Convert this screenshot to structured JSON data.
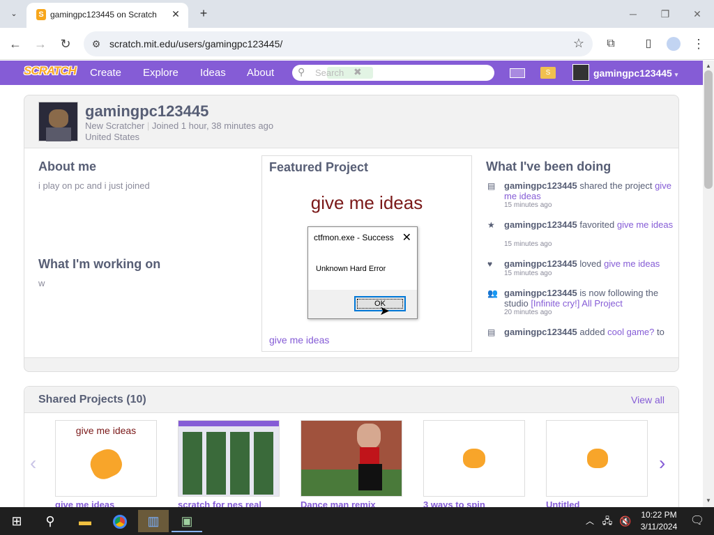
{
  "browser": {
    "tab_title": "gamingpc123445 on Scratch",
    "url": "scratch.mit.edu/users/gamingpc123445/",
    "new_tab": "+",
    "close_tab": "✕"
  },
  "scratch_nav": {
    "logo": "SCRATCH",
    "links": [
      "Create",
      "Explore",
      "Ideas",
      "About"
    ],
    "search_placeholder": "Search",
    "username": "gamingpc123445",
    "mystuff_glyph": "S"
  },
  "profile": {
    "username": "gamingpc123445",
    "rank": "New Scratcher",
    "joined": "Joined 1 hour, 38 minutes ago",
    "location": "United States",
    "about_title": "About me",
    "about_text": "i play on pc and i just joined",
    "working_title": "What I'm working on",
    "working_text": "w",
    "featured_title": "Featured Project",
    "featured_project_art_title": "give me ideas",
    "featured_project_link": "give me ideas",
    "activity_title": "What I've been doing",
    "activity": [
      {
        "user": "gamingpc123445",
        "action": " shared the project ",
        "target": "give me ideas",
        "time": "15 minutes ago",
        "icon": "share-icon"
      },
      {
        "user": "gamingpc123445",
        "action": " favorited ",
        "target": "give me ideas",
        "time": "15 minutes ago",
        "icon": "star-icon"
      },
      {
        "user": "gamingpc123445",
        "action": " loved ",
        "target": "give me ideas",
        "time": "15 minutes ago",
        "icon": "heart-icon"
      },
      {
        "user": "gamingpc123445",
        "action": " is now following the studio ",
        "target": "[Infinite cry!] All Project",
        "time": "20 minutes ago",
        "icon": "follow-icon"
      },
      {
        "user": "gamingpc123445",
        "action": " added ",
        "target": "cool game?",
        "suffix": " to",
        "time": "",
        "icon": "share-icon"
      }
    ]
  },
  "shared": {
    "title": "Shared Projects (10)",
    "view_all": "View all",
    "projects": [
      {
        "title": "give me ideas",
        "thumb_text": "give me ideas"
      },
      {
        "title": "scratch for nes real"
      },
      {
        "title": "Dance man remix"
      },
      {
        "title": "3 ways to spin"
      },
      {
        "title": "Untitled"
      }
    ]
  },
  "dialog": {
    "title": "ctfmon.exe - Success",
    "message": "Unknown Hard Error",
    "ok_label": "OK"
  },
  "taskbar": {
    "time": "10:22 PM",
    "date": "3/11/2024"
  },
  "colors": {
    "scratch_purple": "#855cd6",
    "chrome_tabbar": "#dee3ea",
    "taskbar": "#1f1f1f"
  }
}
